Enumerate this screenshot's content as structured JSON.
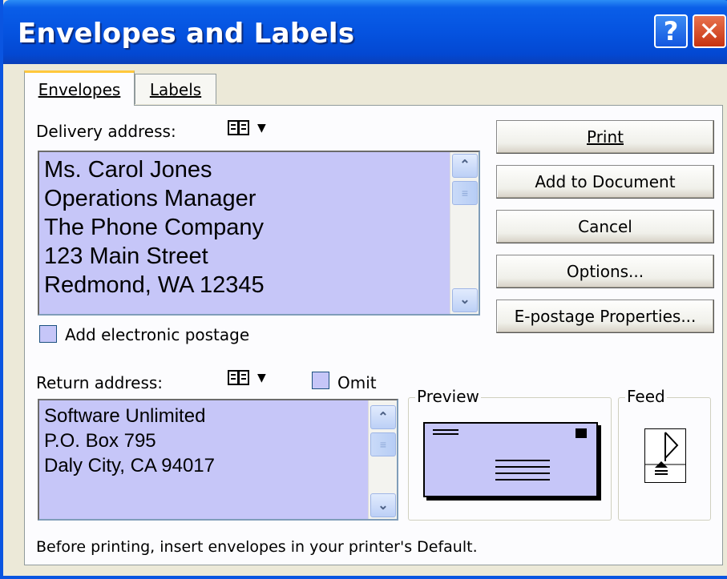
{
  "window": {
    "title": "Envelopes and Labels",
    "help_glyph": "?",
    "close_glyph": "✕"
  },
  "tabs": [
    {
      "label": "Envelopes",
      "active": true
    },
    {
      "label": "Labels",
      "active": false
    }
  ],
  "delivery": {
    "label": "Delivery address:",
    "address_lines": [
      "Ms. Carol Jones",
      "Operations Manager",
      "The Phone Company",
      "123 Main Street",
      "Redmond, WA 12345"
    ]
  },
  "postage": {
    "label": "Add electronic postage",
    "checked": false
  },
  "return": {
    "label": "Return address:",
    "omit_label": "Omit",
    "omit_checked": false,
    "address_lines": [
      "Software Unlimited",
      "P.O. Box 795",
      "Daly City, CA 94017"
    ]
  },
  "buttons": {
    "print": "Print",
    "add_to_document": "Add to Document",
    "cancel": "Cancel",
    "options": "Options...",
    "epostage": "E-postage Properties..."
  },
  "preview": {
    "label": "Preview"
  },
  "feed": {
    "label": "Feed"
  },
  "status_text": "Before printing, insert envelopes in your printer's Default.",
  "icons": {
    "address_book": "address-book-icon",
    "dropdown": "dropdown-caret-icon"
  },
  "colors": {
    "titlebar": "#0553e0",
    "field_bg": "#c6c6f8",
    "dialog_bg": "#ece9d8"
  }
}
